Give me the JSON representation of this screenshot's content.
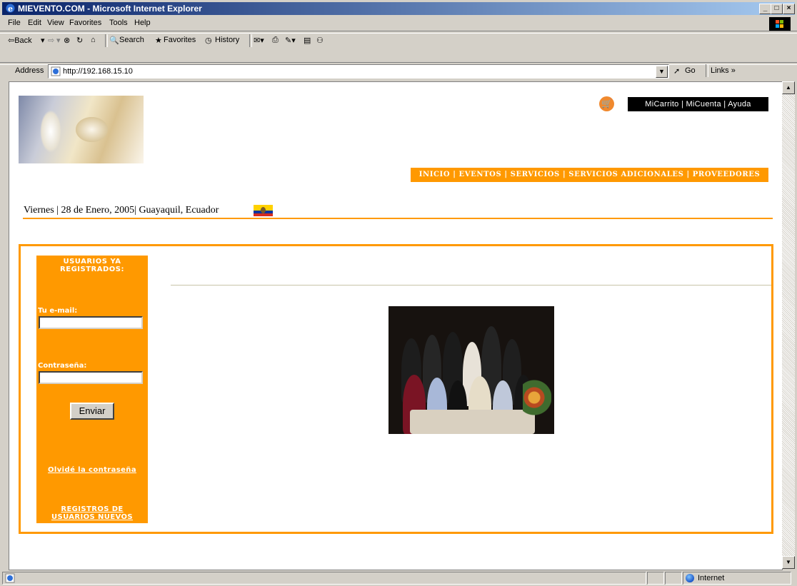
{
  "window": {
    "title": "MIEVENTO.COM - Microsoft Internet Explorer",
    "min": "_",
    "max": "□",
    "close": "×"
  },
  "menu": [
    "File",
    "Edit",
    "View",
    "Favorites",
    "Tools",
    "Help"
  ],
  "toolbar": {
    "back": "⇦Back",
    "forward": "⇨",
    "search": "Search",
    "favorites": "Favorites",
    "history": "History"
  },
  "address": {
    "label": "Address",
    "url": "http://192.168.15.10",
    "go": "Go",
    "links": "Links »"
  },
  "page": {
    "top_links": "MiCarrito  |  MiCuenta  |  Ayuda",
    "main_nav": "INICIO  |  EVENTOS  |  SERVICIOS  |  SERVICIOS ADICIONALES  |  PROVEEDORES",
    "date_line": "Viernes | 28 de Enero, 2005| Guayaquil, Ecuador",
    "login": {
      "title_line1": "USUARIOS YA",
      "title_line2": "REGISTRADOS:",
      "email_label": "Tu e-mail:",
      "email_value": "",
      "password_label": "Contraseña:",
      "password_value": "",
      "submit": "Enviar",
      "forgot": "Olvidé la contraseña",
      "register_line1": "REGISTROS DE",
      "register_line2": "USUARIOS NUEVOS"
    }
  },
  "status": {
    "zone": "Internet"
  },
  "colors": {
    "accent": "#ff9900",
    "title_bar": "#0a246a",
    "chrome": "#d4d0c8"
  }
}
